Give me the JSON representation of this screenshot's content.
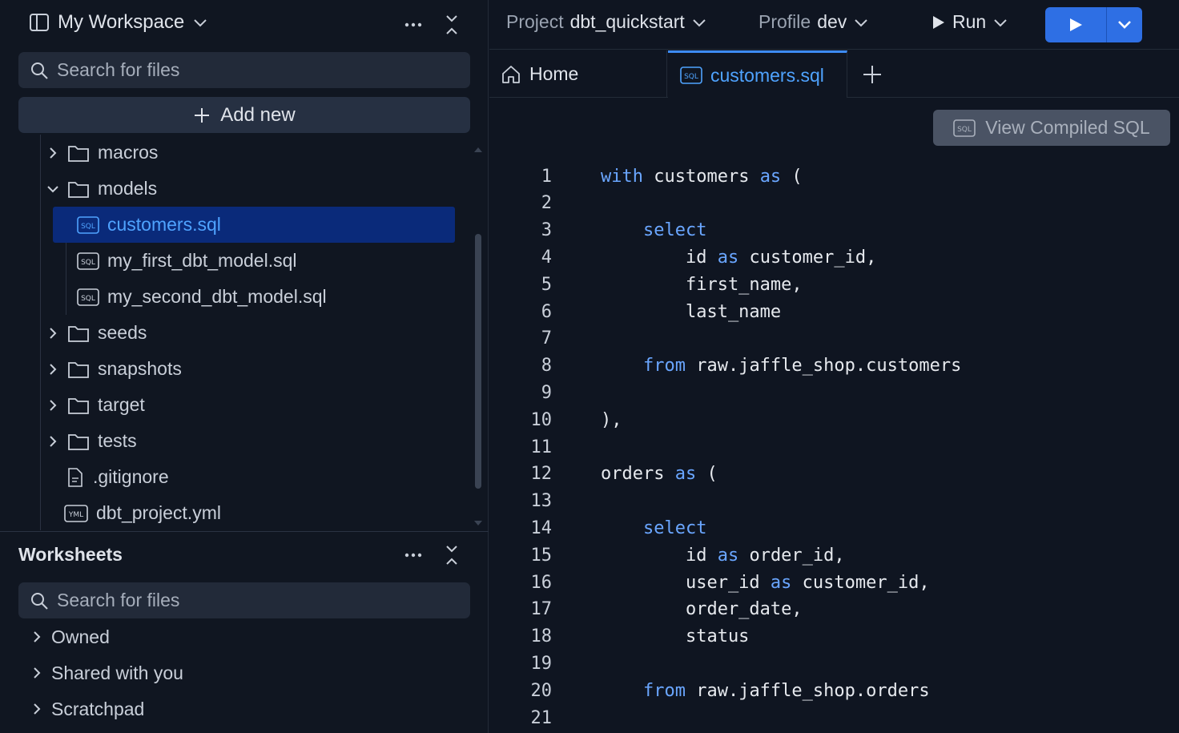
{
  "sidebar": {
    "workspace_title": "My Workspace",
    "search_placeholder": "Search for files",
    "add_new_label": "Add new",
    "tree": [
      {
        "label": "macros",
        "kind": "folder",
        "expanded": false
      },
      {
        "label": "models",
        "kind": "folder",
        "expanded": true
      },
      {
        "label": "customers.sql",
        "kind": "sql",
        "selected": true
      },
      {
        "label": "my_first_dbt_model.sql",
        "kind": "sql"
      },
      {
        "label": "my_second_dbt_model.sql",
        "kind": "sql"
      },
      {
        "label": "seeds",
        "kind": "folder",
        "expanded": false
      },
      {
        "label": "snapshots",
        "kind": "folder",
        "expanded": false
      },
      {
        "label": "target",
        "kind": "folder",
        "expanded": false
      },
      {
        "label": "tests",
        "kind": "folder",
        "expanded": false
      },
      {
        "label": ".gitignore",
        "kind": "file"
      },
      {
        "label": "dbt_project.yml",
        "kind": "yml"
      }
    ],
    "worksheets": {
      "title": "Worksheets",
      "search_placeholder": "Search for files",
      "items": [
        "Owned",
        "Shared with you",
        "Scratchpad"
      ]
    }
  },
  "topbar": {
    "project_key": "Project",
    "project_value": "dbt_quickstart",
    "profile_key": "Profile",
    "profile_value": "dev",
    "run_label": "Run",
    "accent": "#2e6fe4"
  },
  "tabs": {
    "home_label": "Home",
    "active_label": "customers.sql"
  },
  "editor": {
    "view_compiled_label": "View Compiled SQL",
    "lines": [
      {
        "n": "1",
        "code": [
          [
            "kw",
            "with"
          ],
          [
            "t",
            " customers "
          ],
          [
            "kw",
            "as"
          ],
          [
            "t",
            " ("
          ]
        ]
      },
      {
        "n": "2",
        "code": []
      },
      {
        "n": "3",
        "code": [
          [
            "t",
            "    "
          ],
          [
            "kw",
            "select"
          ]
        ]
      },
      {
        "n": "4",
        "code": [
          [
            "t",
            "        id "
          ],
          [
            "kw",
            "as"
          ],
          [
            "t",
            " customer_id,"
          ]
        ]
      },
      {
        "n": "5",
        "code": [
          [
            "t",
            "        first_name,"
          ]
        ]
      },
      {
        "n": "6",
        "code": [
          [
            "t",
            "        last_name"
          ]
        ]
      },
      {
        "n": "7",
        "code": []
      },
      {
        "n": "8",
        "code": [
          [
            "t",
            "    "
          ],
          [
            "kw",
            "from"
          ],
          [
            "t",
            " raw.jaffle_shop.customers"
          ]
        ]
      },
      {
        "n": "9",
        "code": []
      },
      {
        "n": "10",
        "code": [
          [
            "t",
            "),"
          ]
        ]
      },
      {
        "n": "11",
        "code": []
      },
      {
        "n": "12",
        "code": [
          [
            "t",
            "orders "
          ],
          [
            "kw",
            "as"
          ],
          [
            "t",
            " ("
          ]
        ]
      },
      {
        "n": "13",
        "code": []
      },
      {
        "n": "14",
        "code": [
          [
            "t",
            "    "
          ],
          [
            "kw",
            "select"
          ]
        ]
      },
      {
        "n": "15",
        "code": [
          [
            "t",
            "        id "
          ],
          [
            "kw",
            "as"
          ],
          [
            "t",
            " order_id,"
          ]
        ]
      },
      {
        "n": "16",
        "code": [
          [
            "t",
            "        user_id "
          ],
          [
            "kw",
            "as"
          ],
          [
            "t",
            " customer_id,"
          ]
        ]
      },
      {
        "n": "17",
        "code": [
          [
            "t",
            "        order_date,"
          ]
        ]
      },
      {
        "n": "18",
        "code": [
          [
            "t",
            "        status"
          ]
        ]
      },
      {
        "n": "19",
        "code": []
      },
      {
        "n": "20",
        "code": [
          [
            "t",
            "    "
          ],
          [
            "kw",
            "from"
          ],
          [
            "t",
            " raw.jaffle_shop.orders"
          ]
        ]
      },
      {
        "n": "21",
        "code": []
      }
    ]
  }
}
